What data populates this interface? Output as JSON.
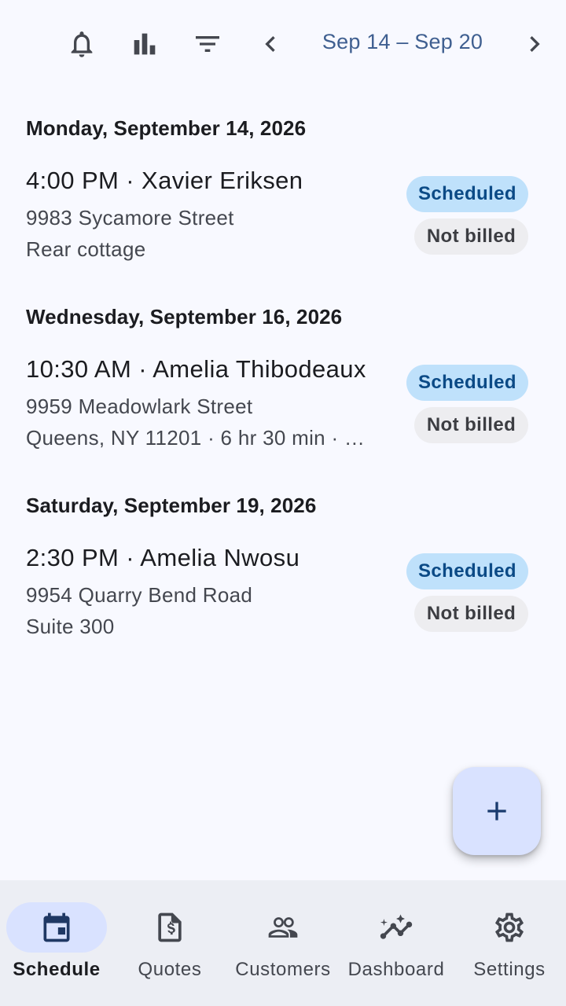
{
  "header": {
    "date_range": "Sep 14 – Sep 20",
    "icons": [
      "notifications-icon",
      "bar-chart-icon",
      "filter-icon",
      "chevron-left-icon",
      "chevron-right-icon"
    ]
  },
  "days": [
    {
      "header": "Monday, September 14, 2026",
      "appointment": {
        "title": "4:00 PM · Xavier Eriksen",
        "line1": "9983 Sycamore Street",
        "line2": "Rear cottage",
        "status": "Scheduled",
        "billing": "Not billed"
      }
    },
    {
      "header": "Wednesday, September 16, 2026",
      "appointment": {
        "title": "10:30 AM · Amelia Thibodeaux",
        "line1": "9959 Meadowlark Street",
        "line2": "Queens, NY 11201 · 6 hr 30 min · …",
        "status": "Scheduled",
        "billing": "Not billed"
      }
    },
    {
      "header": "Saturday, September 19, 2026",
      "appointment": {
        "title": "2:30 PM · Amelia Nwosu",
        "line1": "9954 Quarry Bend Road",
        "line2": "Suite 300",
        "status": "Scheduled",
        "billing": "Not billed"
      }
    }
  ],
  "fab": {
    "icon": "add-icon"
  },
  "bottom_nav": {
    "items": [
      {
        "label": "Schedule",
        "icon": "calendar-icon",
        "active": true
      },
      {
        "label": "Quotes",
        "icon": "invoice-icon",
        "active": false
      },
      {
        "label": "Customers",
        "icon": "people-icon",
        "active": false
      },
      {
        "label": "Dashboard",
        "icon": "insights-icon",
        "active": false
      },
      {
        "label": "Settings",
        "icon": "gear-icon",
        "active": false
      }
    ]
  },
  "colors": {
    "accent": "#3f5f90",
    "status_chip_bg": "#bfe1fb",
    "status_chip_text": "#0b4a86",
    "billing_chip_bg": "#ededf0",
    "nav_active_bg": "#d9e2ff"
  }
}
